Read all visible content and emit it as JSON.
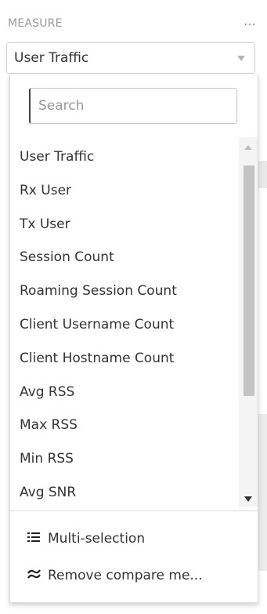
{
  "header": {
    "label": "MEASURE",
    "more_icon": "⋯"
  },
  "select": {
    "value": "User Traffic"
  },
  "search": {
    "placeholder": "Search"
  },
  "options": [
    "User Traffic",
    "Rx User",
    "Tx User",
    "Session Count",
    "Roaming Session Count",
    "Client Username Count",
    "Client Hostname Count",
    "Avg RSS",
    "Max RSS",
    "Min RSS",
    "Avg SNR"
  ],
  "footer": {
    "multi_selection": {
      "label": "Multi-selection",
      "icon": "list-icon"
    },
    "remove_compare": {
      "label": "Remove compare me...",
      "icon": "compare-icon"
    }
  }
}
